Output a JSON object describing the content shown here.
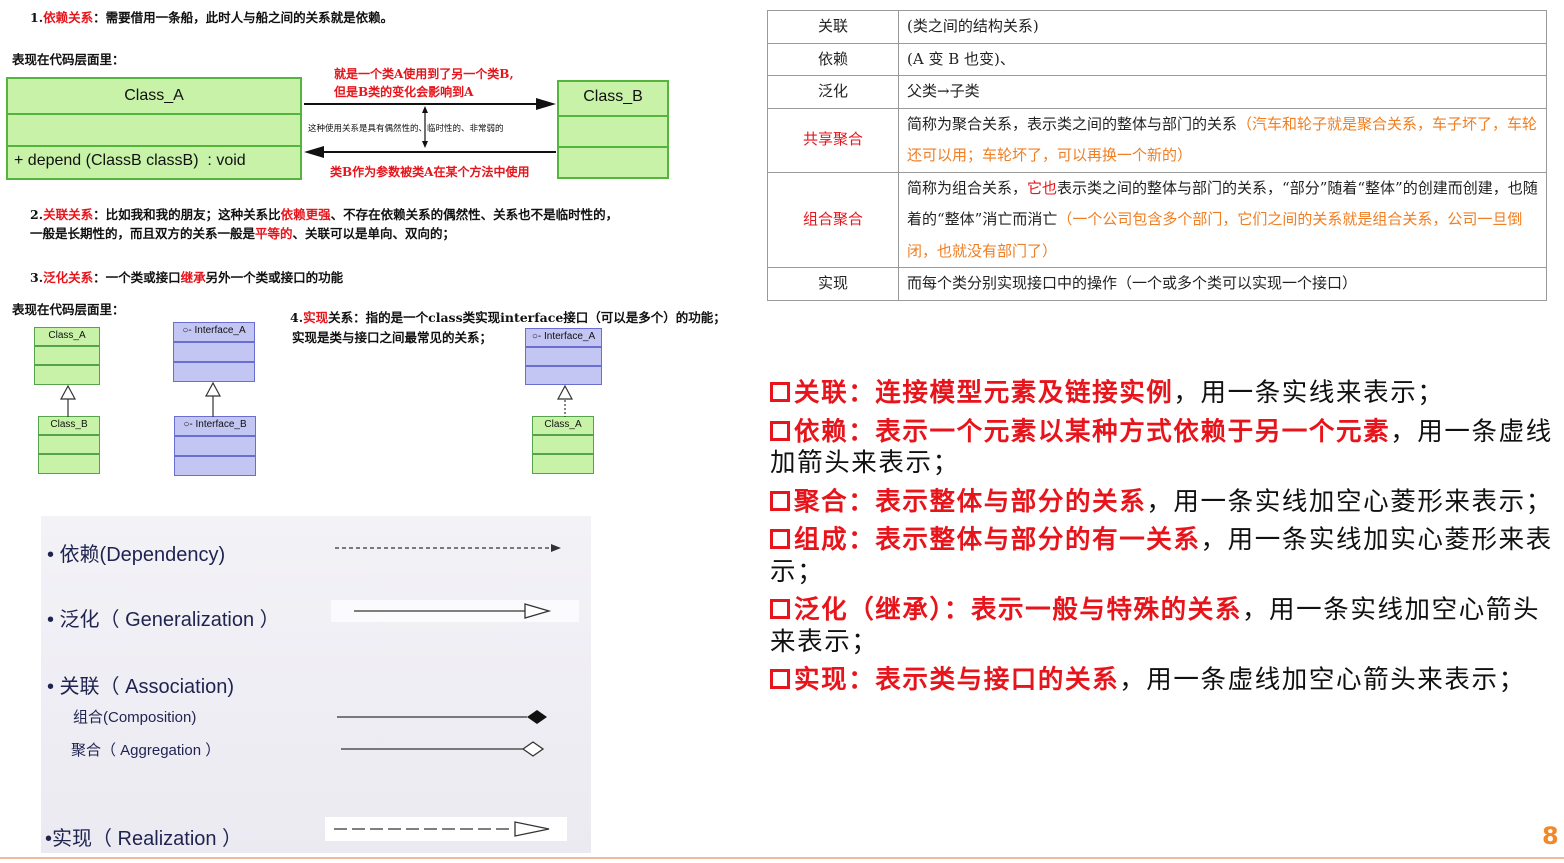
{
  "left": {
    "dependency": {
      "num": "1.",
      "title": "依赖关系",
      "text": "：需要借用一条船，此时人与船之间的关系就是依赖。",
      "code_label": "表现在代码层面里：",
      "class_a": "Class_A",
      "method": "+ depend (ClassB classB)  : void",
      "class_b": "Class_B",
      "ann_top_1": "就是一个类A使用到了另一个类B,",
      "ann_top_2": "但是B类的变化会影响到A",
      "ann_mid": "这种使用关系是具有偶然性的、临时性的、非常弱的",
      "ann_bottom": "类B作为参数被类A在某个方法中使用"
    },
    "association": {
      "num": "2.",
      "title": "关联关系",
      "t1": "：比如我和我的朋友；这种关系比",
      "t2": "依赖更强",
      "t3": "、不存在依赖关系的偶然性、关系也不是临时性的，",
      "t4": "一般是长期性的，而且双方的关系一般是",
      "t5": "平等的",
      "t6": "、关联可以是单向、双向的；"
    },
    "generalization": {
      "num": "3.",
      "title": "泛化关系",
      "t1": "：一个类或接口",
      "t2": "继承",
      "t3": "另外一个类或接口的功能",
      "code_label": "表现在代码层面里：",
      "box1_top": "Class_A",
      "box1_bottom": "Class_B",
      "box2_top": "○- Interface_A",
      "box2_bottom": "○- Interface_B"
    },
    "realization": {
      "num": "4.",
      "title": "实现",
      "t1": "关系：指的是一个class类实现interface接口（可以是多个）的功能；",
      "t2": "实现是类与接口之间最常见的关系；",
      "iface": "○- Interface_A",
      "cls": "Class_A"
    },
    "legend": {
      "dependency": "• 依赖(Dependency)",
      "generalization": "• 泛化（ Generalization ）",
      "association": "• 关联（ Association)",
      "composition": "组合(Composition)",
      "aggregation": "聚合（ Aggregation ）",
      "realization": "•实现（ Realization ）"
    }
  },
  "table": {
    "rows": [
      {
        "key": "关联",
        "plain": "(类之间的结构关系)",
        "extra": ""
      },
      {
        "key": "依赖",
        "plain": "(A 变 B 也变)、",
        "extra": ""
      },
      {
        "key": "泛化",
        "plain": "父类→子类",
        "extra": ""
      },
      {
        "key": "共享聚合",
        "plain": "简称为聚合关系，表示类之间的整体与部门的关系",
        "extra": "（汽车和轮子就是聚合关系，车子坏了，车轮还可以用；车轮坏了，可以再换一个新的）"
      },
      {
        "key": "组合聚合",
        "plain": "简称为组合关系，",
        "red": "它也",
        "plain2": "表示类之间的整体与部门的关系，“部分”随着“整体”的创建而创建，也随着的“整体”消亡而消亡",
        "extra": "（一个公司包含多个部门，它们之间的关系就是组合关系，公司一旦倒闭，也就没有部门了）"
      },
      {
        "key": "实现",
        "plain": "而每个类分别实现接口中的操作（一个或多个类可以实现一个接口）",
        "extra": ""
      }
    ]
  },
  "definitions": [
    {
      "hl": "关联：连接模型元素及链接实例",
      "rest": "，用一条实线来表示；"
    },
    {
      "hl": "依赖：表示一个元素以某种方式依赖于另一个元素",
      "rest": "，用一条虚线加箭头来表示；"
    },
    {
      "hl": "聚合：表示整体与部分的关系",
      "rest": "，用一条实线加空心菱形来表示；"
    },
    {
      "hl": "组成：表示整体与部分的有一关系",
      "rest": "，用一条实线加实心菱形来表示；"
    },
    {
      "hl": "泛化（继承）：表示一般与特殊的关系",
      "rest": "，用一条实线加空心箭头来表示；"
    },
    {
      "hl": "实现：表示类与接口的关系",
      "rest": "，用一条虚线加空心箭头来表示；"
    }
  ],
  "page_number": "8",
  "colors": {
    "highlight": "#e8141b",
    "uml_green": "#c7f2a8",
    "uml_blue": "#c3c6f3",
    "table_orange": "#f07e22",
    "page_number": "#f1882a"
  }
}
